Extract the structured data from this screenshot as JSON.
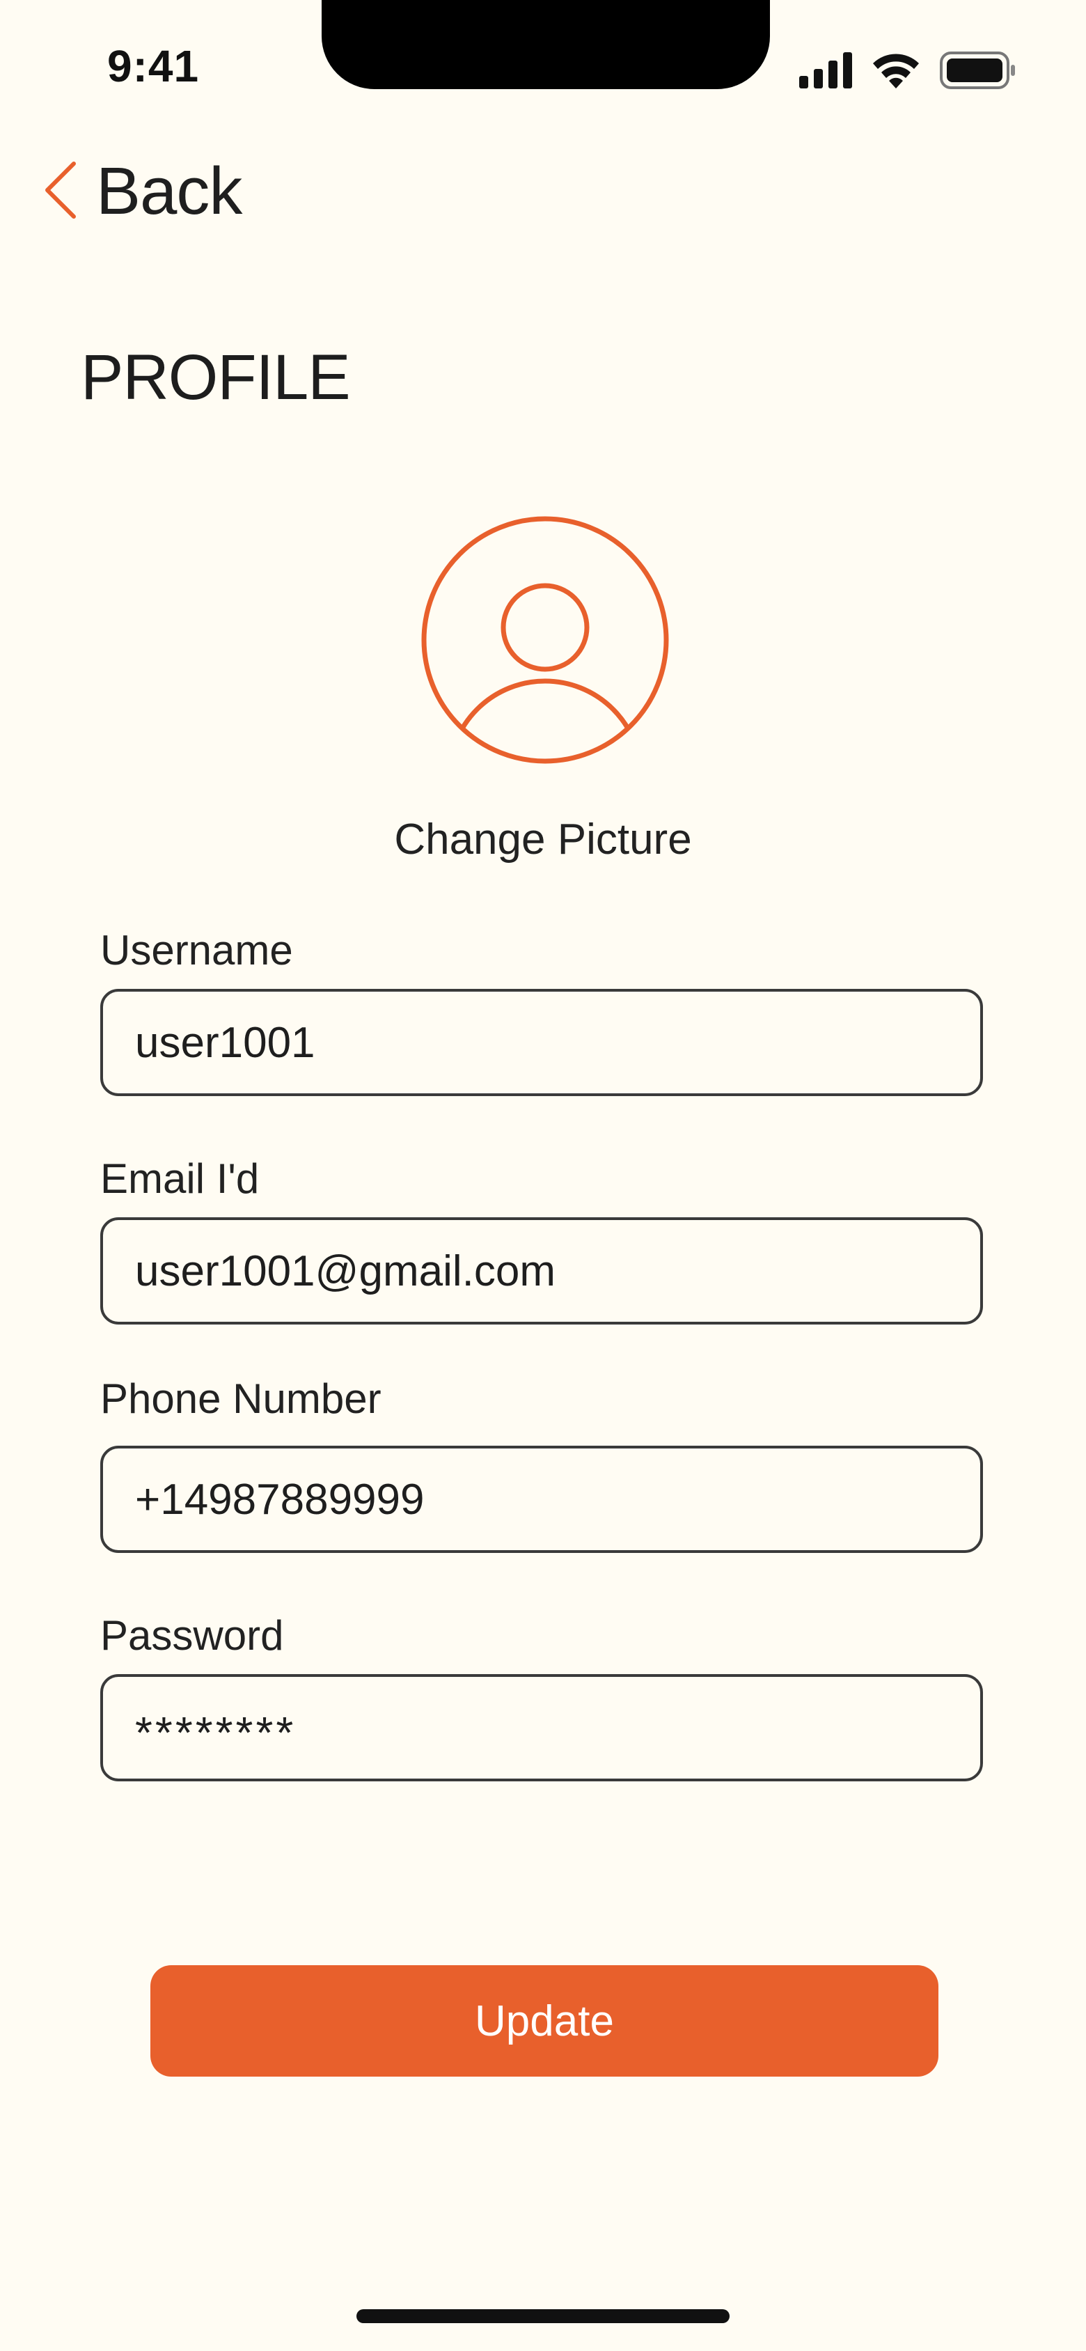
{
  "status_bar": {
    "time": "9:41",
    "icons": [
      "signal-icon",
      "wifi-icon",
      "battery-icon"
    ]
  },
  "nav": {
    "back_label": "Back",
    "back_icon": "chevron-left-icon"
  },
  "page": {
    "title": "PROFILE"
  },
  "avatar": {
    "icon": "user-avatar-icon",
    "change_label": "Change Picture"
  },
  "form": {
    "fields": [
      {
        "label": "Username",
        "value": "user1001"
      },
      {
        "label": "Email I'd",
        "value": "user1001@gmail.com"
      },
      {
        "label": "Phone Number",
        "value": "+14987889999"
      },
      {
        "label": "Password",
        "value": "********"
      }
    ],
    "submit_label": "Update"
  },
  "colors": {
    "accent": "#e8602c",
    "background": "#fffcf3",
    "text": "#232323",
    "border": "#3a3a3a"
  }
}
